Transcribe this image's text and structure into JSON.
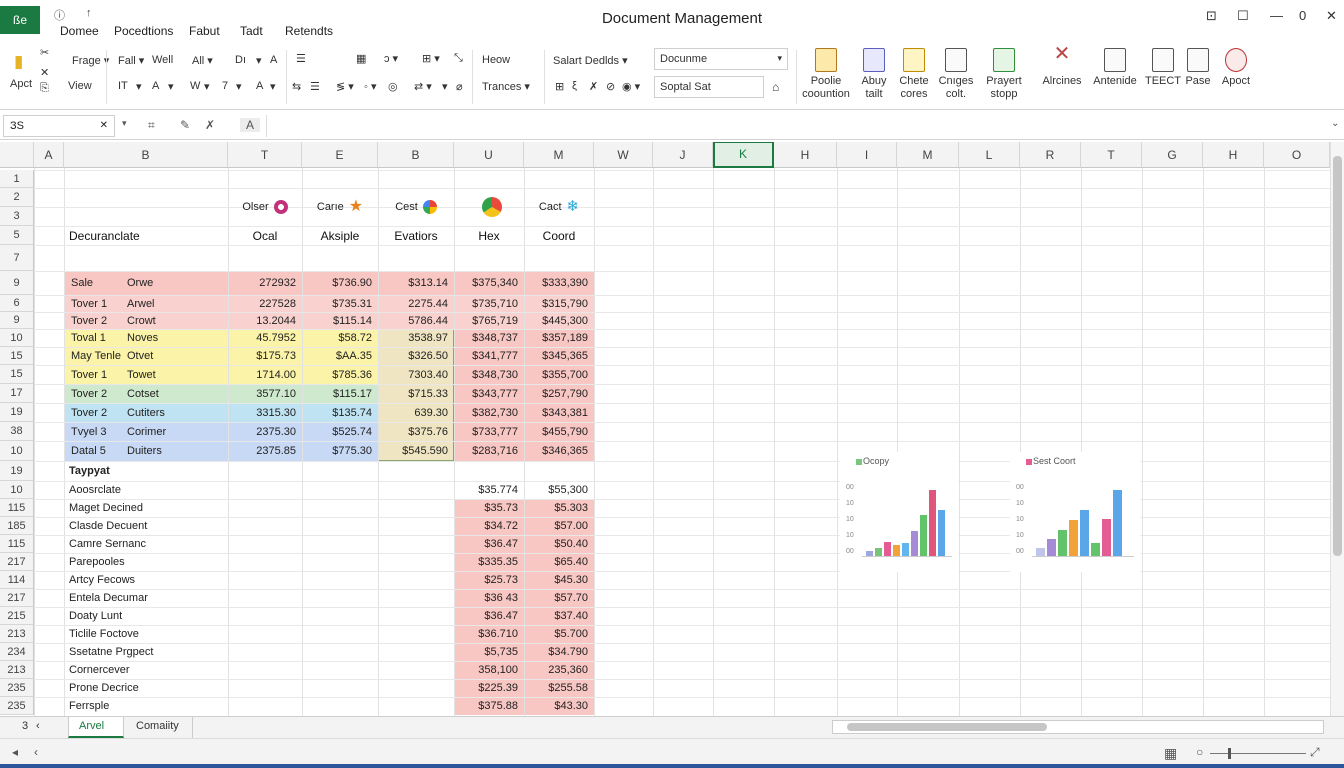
{
  "titlebar": {
    "file_label": "ße",
    "quick_icons": [
      "ⓘ",
      "↑"
    ],
    "tabs": [
      "Domee",
      "Pocedtions",
      "Fabut",
      "Tadt",
      "Retendts"
    ],
    "title": "Document Management",
    "window_controls": [
      "⊡",
      "☐",
      "—",
      "0",
      "✕"
    ]
  },
  "ribbon": {
    "clipboard": {
      "paste": "Apct",
      "icon_glyphs": [
        "✂",
        "✕",
        "⎘"
      ],
      "row1": [
        "Frage ▾"
      ],
      "row2": [
        "View"
      ]
    },
    "font": {
      "row1": [
        "Fall ▾",
        "Well",
        "All ▾",
        "Dı",
        "▾",
        "A"
      ],
      "row2": [
        "IT",
        "▾",
        "A",
        "▾",
        "W",
        "▾",
        "7",
        "▾",
        "A",
        "▾"
      ]
    },
    "align": {
      "row1": [
        "☰",
        "▦",
        "ɔ ▾",
        "⊞ ▾",
        "⤡"
      ],
      "row2": [
        "⇆",
        "☰",
        "≶ ▾",
        "◦ ▾",
        "◎",
        "⇄ ▾",
        "▾",
        "⌀"
      ]
    },
    "number": {
      "row1": [
        "Heow"
      ],
      "row2": [
        "Trances ▾"
      ]
    },
    "styles": {
      "row1": [
        "Salart Dedlds ▾"
      ],
      "row2": [
        "⊞",
        "ξ",
        "✗",
        "⊘",
        "◉ ▾"
      ]
    },
    "dropdown1": "Docunme",
    "dropdown2": "Soptal Sat",
    "big_buttons": [
      {
        "l1": "Poolie",
        "l2": "coountion"
      },
      {
        "l1": "Abuy",
        "l2": "tailt"
      },
      {
        "l1": "Chete",
        "l2": "cores"
      },
      {
        "l1": "Cnıges",
        "l2": "colt."
      },
      {
        "l1": "Prayert",
        "l2": "stopp"
      },
      {
        "l1": "Alrcines",
        "l2": ""
      },
      {
        "l1": "Antenide",
        "l2": ""
      },
      {
        "l1": "TEECT",
        "l2": ""
      },
      {
        "l1": "Pase",
        "l2": ""
      },
      {
        "l1": "Apoct",
        "l2": ""
      }
    ]
  },
  "formula_bar": {
    "name_box": "ЗS",
    "icons": [
      "✕",
      "▾",
      "⌗",
      "✎",
      "✗",
      "A"
    ],
    "scroll_icon": "⌄"
  },
  "columns": [
    "A",
    "B",
    "T",
    "E",
    "B",
    "U",
    "M",
    "W",
    "J",
    "K",
    "H",
    "I",
    "M",
    "L",
    "R",
    "T",
    "G",
    "H",
    "O"
  ],
  "rows": [
    "1",
    "2",
    "3",
    "5",
    "7",
    "9",
    "6",
    "9",
    "10",
    "15",
    "15",
    "17",
    "19",
    "38",
    "10",
    "19",
    "10",
    "115",
    "185",
    "115",
    "217",
    "114",
    "217",
    "215",
    "213",
    "234",
    "213",
    "235",
    "235"
  ],
  "header_row": {
    "label": "Decuranclate",
    "cols": [
      {
        "top": "Olser",
        "bottom": "Ocal",
        "icon": "pink"
      },
      {
        "top": "Carıe",
        "bottom": "Aksiple",
        "icon": "star"
      },
      {
        "top": "Cest",
        "bottom": "Evatiors",
        "icon": "google"
      },
      {
        "top": "",
        "bottom": "Hex",
        "icon": "chrome"
      },
      {
        "top": "Cact",
        "bottom": "Coord",
        "icon": "snow"
      }
    ]
  },
  "table_rows": [
    {
      "a": "Sale",
      "b": "Orwe",
      "t": "272932",
      "e": "$736.90",
      "b2": "$313.14",
      "u": "$375,340",
      "m": "$333,390",
      "color": "#f8c7c3",
      "c5color": "#f8c7c3"
    },
    {
      "a": "Tover 1",
      "b": "Arwel",
      "t": "227528",
      "e": "$735.31",
      "b2": "2275.44",
      "u": "$735,710",
      "m": "$315,790",
      "color": "#f9d2cf",
      "c5color": "#f9d2cf"
    },
    {
      "a": "Tover 2",
      "b": "Crowt",
      "t": "13.2044",
      "e": "$115.14",
      "b2": "5786.44",
      "u": "$765,719",
      "m": "$445,300",
      "color": "#f9d2cf",
      "c5color": "#f9d2cf"
    },
    {
      "a": "Toval 1",
      "b": "Noves",
      "t": "45.7952",
      "e": "$58.72",
      "b2": "3538.97",
      "u": "$348,737",
      "m": "$357,189",
      "color": "#fbf3a7",
      "c5color": "#f8c7c3"
    },
    {
      "a": "May Tenle",
      "b": "Otvet",
      "t": "$175.73",
      "e": "$AA.35",
      "b2": "$326.50",
      "u": "$341,777",
      "m": "$345,365",
      "color": "#fbf3a7",
      "c5color": "#f8c7c3"
    },
    {
      "a": "Tover 1",
      "b": "Towet",
      "t": "1714.00",
      "e": "$785.36",
      "b2": "7303.40",
      "u": "$348,730",
      "m": "$355,700",
      "color": "#fbf3a7",
      "c5color": "#f8c7c3"
    },
    {
      "a": "Tover 2",
      "b": "Cotset",
      "t": "3577.10",
      "e": "$115.17",
      "b2": "$715.33",
      "u": "$343,777",
      "m": "$257,790",
      "color": "#cfe9cf",
      "c5color": "#f8c7c3"
    },
    {
      "a": "Tover 2",
      "b": "Cutiters",
      "t": "3315.30",
      "e": "$135.74",
      "b2": "639.30",
      "u": "$382,730",
      "m": "$343,381",
      "color": "#bfe3f2",
      "c5color": "#f8c7c3"
    },
    {
      "a": "Tvyel 3",
      "b": "Corimer",
      "t": "2375.30",
      "e": "$525.74",
      "b2": "$375.76",
      "u": "$733,777",
      "m": "$455,790",
      "color": "#c8d9f5",
      "c5color": "#f8c7c3"
    },
    {
      "a": "Datal 5",
      "b": "Duiters",
      "t": "2375.85",
      "e": "$775.30",
      "b2": "$545.590",
      "u": "$283,716",
      "m": "$346,365",
      "color": "#c8d9f5",
      "c5color": "#f8c7c3"
    }
  ],
  "section2": {
    "title": "Taypyat",
    "rows": [
      {
        "label": "Aoosrclate",
        "u": "$35.774",
        "m": "$55,300"
      },
      {
        "label": "Maget Decined",
        "u": "$35.73",
        "m": "$5.303"
      },
      {
        "label": "Clasde Decuent",
        "u": "$34.72",
        "m": "$57.00"
      },
      {
        "label": "Camre Sernanc",
        "u": "$36.47",
        "m": "$50.40"
      },
      {
        "label": "Parepooles",
        "u": "$335.35",
        "m": "$65.40"
      },
      {
        "label": "Artcy Fecows",
        "u": "$25.73",
        "m": "$45.30"
      },
      {
        "label": "Entela Decumar",
        "u": "$36 43",
        "m": "$57.70"
      },
      {
        "label": "Doaty Lunt",
        "u": "$36.47",
        "m": "$37.40"
      },
      {
        "label": "Ticlile Foctove",
        "u": "$36.710",
        "m": "$5.700"
      },
      {
        "label": "Ssetatne Prgpect",
        "u": "$5,735",
        "m": "$34.790"
      },
      {
        "label": "Cornercever",
        "u": "358,100",
        "m": "235,360"
      },
      {
        "label": "Prone Decrice",
        "u": "$225.39",
        "m": "$255.58"
      },
      {
        "label": "Ferrsple",
        "u": "$375.88",
        "m": "$43.30"
      }
    ]
  },
  "charts": [
    {
      "legend": "Ocopy",
      "colors": [
        "#9fa6e0",
        "#77c47b",
        "#e35d94",
        "#f2a23a",
        "#63b5f0",
        "#a58ad6",
        "#62c36a",
        "#e0557c",
        "#5aa6e8"
      ],
      "values": [
        3,
        5,
        9,
        7,
        8,
        16,
        26,
        42,
        29
      ],
      "ticks": [
        "00",
        "10",
        "10",
        "10",
        "00"
      ]
    },
    {
      "legend": "Sest Coort",
      "colors": [
        "#bfc5ea",
        "#a58ad6",
        "#62c36a",
        "#f2a23a",
        "#5aa6e8",
        "#62c36a",
        "#e35d94",
        "#5aa6e8"
      ],
      "values": [
        6,
        13,
        20,
        27,
        35,
        10,
        28,
        50
      ],
      "ticks": [
        "00",
        "10",
        "10",
        "10",
        "00"
      ]
    }
  ],
  "sheet_tabs": {
    "nav": [
      "3",
      "‹"
    ],
    "tabs": [
      "Arvel",
      "Comaiity"
    ]
  },
  "status": {
    "nav": [
      "◂",
      "‹"
    ],
    "icons": [
      "▦",
      "○"
    ]
  }
}
